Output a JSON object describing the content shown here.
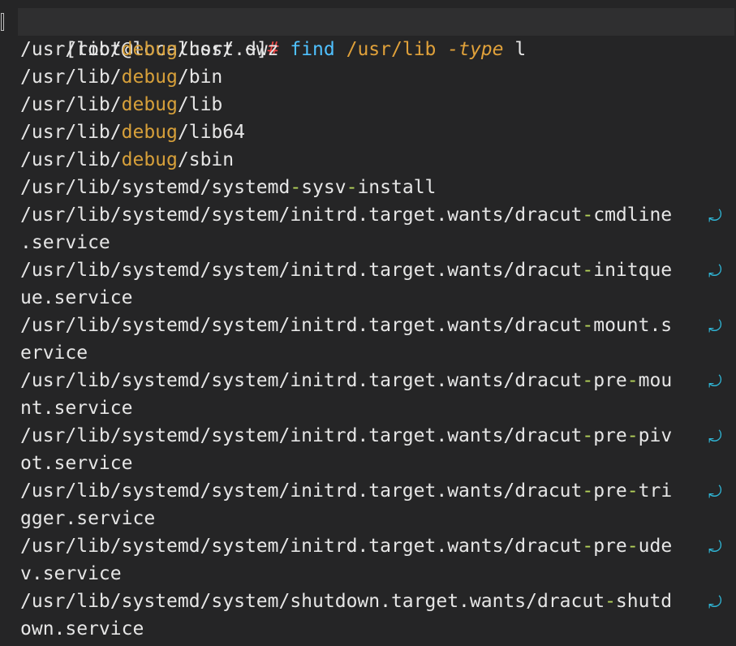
{
  "prompt": {
    "user_host": "[root@localhost ~]",
    "symbol": "#",
    "command": "find",
    "path": "/usr/lib",
    "flag": "-type",
    "value": "l"
  },
  "output": [
    {
      "segments": [
        [
          "p",
          "/usr/lib/"
        ],
        [
          "dbg",
          "debug"
        ],
        [
          "p",
          "/usr/.dwz"
        ]
      ],
      "wrap": false
    },
    {
      "segments": [
        [
          "p",
          "/usr/lib/"
        ],
        [
          "dbg",
          "debug"
        ],
        [
          "p",
          "/bin"
        ]
      ],
      "wrap": false
    },
    {
      "segments": [
        [
          "p",
          "/usr/lib/"
        ],
        [
          "dbg",
          "debug"
        ],
        [
          "p",
          "/lib"
        ]
      ],
      "wrap": false
    },
    {
      "segments": [
        [
          "p",
          "/usr/lib/"
        ],
        [
          "dbg",
          "debug"
        ],
        [
          "p",
          "/lib64"
        ]
      ],
      "wrap": false
    },
    {
      "segments": [
        [
          "p",
          "/usr/lib/"
        ],
        [
          "dbg",
          "debug"
        ],
        [
          "p",
          "/sbin"
        ]
      ],
      "wrap": false
    },
    {
      "segments": [
        [
          "p",
          "/usr/lib/systemd/systemd"
        ],
        [
          "hy",
          "-"
        ],
        [
          "p",
          "sysv"
        ],
        [
          "hy",
          "-"
        ],
        [
          "p",
          "install"
        ]
      ],
      "wrap": false
    },
    {
      "segments": [
        [
          "p",
          "/usr/lib/systemd/system/initrd.target.wants/dracut"
        ],
        [
          "hy",
          "-"
        ],
        [
          "p",
          "cmdline"
        ]
      ],
      "wrap": true
    },
    {
      "segments": [
        [
          "p",
          ".service"
        ]
      ],
      "wrap": false
    },
    {
      "segments": [
        [
          "p",
          "/usr/lib/systemd/system/initrd.target.wants/dracut"
        ],
        [
          "hy",
          "-"
        ],
        [
          "p",
          "initque"
        ]
      ],
      "wrap": true
    },
    {
      "segments": [
        [
          "p",
          "ue.service"
        ]
      ],
      "wrap": false
    },
    {
      "segments": [
        [
          "p",
          "/usr/lib/systemd/system/initrd.target.wants/dracut"
        ],
        [
          "hy",
          "-"
        ],
        [
          "p",
          "mount.s"
        ]
      ],
      "wrap": true
    },
    {
      "segments": [
        [
          "p",
          "ervice"
        ]
      ],
      "wrap": false
    },
    {
      "segments": [
        [
          "p",
          "/usr/lib/systemd/system/initrd.target.wants/dracut"
        ],
        [
          "hy",
          "-"
        ],
        [
          "p",
          "pre"
        ],
        [
          "hy",
          "-"
        ],
        [
          "p",
          "mou"
        ]
      ],
      "wrap": true
    },
    {
      "segments": [
        [
          "p",
          "nt.service"
        ]
      ],
      "wrap": false
    },
    {
      "segments": [
        [
          "p",
          "/usr/lib/systemd/system/initrd.target.wants/dracut"
        ],
        [
          "hy",
          "-"
        ],
        [
          "p",
          "pre"
        ],
        [
          "hy",
          "-"
        ],
        [
          "p",
          "piv"
        ]
      ],
      "wrap": true
    },
    {
      "segments": [
        [
          "p",
          "ot.service"
        ]
      ],
      "wrap": false
    },
    {
      "segments": [
        [
          "p",
          "/usr/lib/systemd/system/initrd.target.wants/dracut"
        ],
        [
          "hy",
          "-"
        ],
        [
          "p",
          "pre"
        ],
        [
          "hy",
          "-"
        ],
        [
          "p",
          "tri"
        ]
      ],
      "wrap": true
    },
    {
      "segments": [
        [
          "p",
          "gger.service"
        ]
      ],
      "wrap": false
    },
    {
      "segments": [
        [
          "p",
          "/usr/lib/systemd/system/initrd.target.wants/dracut"
        ],
        [
          "hy",
          "-"
        ],
        [
          "p",
          "pre"
        ],
        [
          "hy",
          "-"
        ],
        [
          "p",
          "ude"
        ]
      ],
      "wrap": true
    },
    {
      "segments": [
        [
          "p",
          "v.service"
        ]
      ],
      "wrap": false
    },
    {
      "segments": [
        [
          "p",
          "/usr/lib/systemd/system/shutdown.target.wants/dracut"
        ],
        [
          "hy",
          "-"
        ],
        [
          "p",
          "shutd"
        ]
      ],
      "wrap": true
    },
    {
      "segments": [
        [
          "p",
          "own.service"
        ]
      ],
      "wrap": false
    }
  ],
  "wrap_glyph": "⤾",
  "colors": {
    "background": "#252526",
    "text": "#e6e6e6",
    "prompt_hash": "#f44747",
    "command": "#4fc1ff",
    "argument": "#e0a13a",
    "debug_dir": "#d7a03a",
    "hyphen": "#b5d35a",
    "wrap_indicator": "#2fb6d6"
  }
}
